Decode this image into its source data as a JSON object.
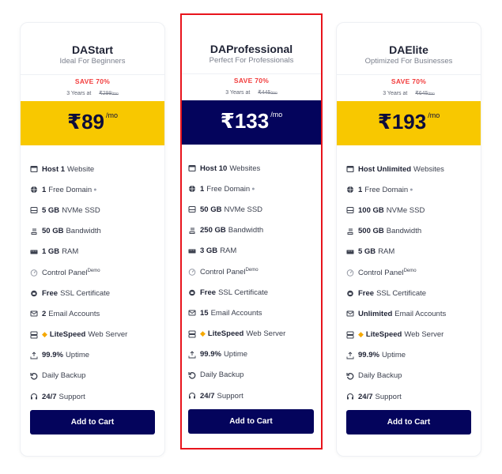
{
  "plans": [
    {
      "name": "DAStart",
      "tagline": "Ideal For Beginners",
      "save": "SAVE 70%",
      "years_label": "3 Years at",
      "old_price": "₹299",
      "old_unit": "/mo",
      "price": "₹89",
      "price_unit": "/mo",
      "features": [
        {
          "icon": "browser-window-icon",
          "bold": "Host 1",
          "text": "Website"
        },
        {
          "icon": "globe-icon",
          "bold": "1",
          "text": "Free Domain",
          "info": "info-icon"
        },
        {
          "icon": "ssd-icon",
          "bold": "5 GB",
          "text": "NVMe SSD"
        },
        {
          "icon": "bandwidth-icon",
          "bold": "50 GB",
          "text": "Bandwidth"
        },
        {
          "icon": "ram-icon",
          "bold": "1 GB",
          "text": "RAM"
        },
        {
          "icon": "dashboard-icon",
          "bold": "",
          "text": "Control Panel",
          "sup": "Demo"
        },
        {
          "icon": "ssl-icon",
          "bold": "Free",
          "text": "SSL Certificate"
        },
        {
          "icon": "email-icon",
          "bold": "2",
          "text": "Email Accounts"
        },
        {
          "icon": "server-icon",
          "bold": "LiteSpeed",
          "text": "Web Server",
          "litespeed": true
        },
        {
          "icon": "uptime-icon",
          "bold": "99.9%",
          "text": "Uptime"
        },
        {
          "icon": "backup-icon",
          "bold": "",
          "text": "Daily Backup"
        },
        {
          "icon": "headset-icon",
          "bold": "24/7",
          "text": "Support"
        }
      ],
      "button": "Add to Cart"
    },
    {
      "name": "DAProfessional",
      "tagline": "Perfect For Professionals",
      "save": "SAVE 70%",
      "years_label": "3 Years at",
      "old_price": "₹445",
      "old_unit": "/mo",
      "price": "₹133",
      "price_unit": "/mo",
      "features": [
        {
          "icon": "browser-window-icon",
          "bold": "Host 10",
          "text": "Websites"
        },
        {
          "icon": "globe-icon",
          "bold": "1",
          "text": "Free Domain",
          "info": "info-icon"
        },
        {
          "icon": "ssd-icon",
          "bold": "50 GB",
          "text": "NVMe SSD"
        },
        {
          "icon": "bandwidth-icon",
          "bold": "250 GB",
          "text": "Bandwidth"
        },
        {
          "icon": "ram-icon",
          "bold": "3 GB",
          "text": "RAM"
        },
        {
          "icon": "dashboard-icon",
          "bold": "",
          "text": "Control Panel",
          "sup": "Demo"
        },
        {
          "icon": "ssl-icon",
          "bold": "Free",
          "text": "SSL Certificate"
        },
        {
          "icon": "email-icon",
          "bold": "15",
          "text": "Email Accounts"
        },
        {
          "icon": "server-icon",
          "bold": "LiteSpeed",
          "text": "Web Server",
          "litespeed": true
        },
        {
          "icon": "uptime-icon",
          "bold": "99.9%",
          "text": "Uptime"
        },
        {
          "icon": "backup-icon",
          "bold": "",
          "text": "Daily Backup"
        },
        {
          "icon": "headset-icon",
          "bold": "24/7",
          "text": "Support"
        }
      ],
      "button": "Add to Cart"
    },
    {
      "name": "DAElite",
      "tagline": "Optimized For Businesses",
      "save": "SAVE 70%",
      "years_label": "3 Years at",
      "old_price": "₹645",
      "old_unit": "/mo",
      "price": "₹193",
      "price_unit": "/mo",
      "features": [
        {
          "icon": "browser-window-icon",
          "bold": "Host Unlimited",
          "text": "Websites"
        },
        {
          "icon": "globe-icon",
          "bold": "1",
          "text": "Free Domain",
          "info": "info-icon"
        },
        {
          "icon": "ssd-icon",
          "bold": "100 GB",
          "text": "NVMe SSD"
        },
        {
          "icon": "bandwidth-icon",
          "bold": "500 GB",
          "text": "Bandwidth"
        },
        {
          "icon": "ram-icon",
          "bold": "5 GB",
          "text": "RAM"
        },
        {
          "icon": "dashboard-icon",
          "bold": "",
          "text": "Control Panel",
          "sup": "Demo"
        },
        {
          "icon": "ssl-icon",
          "bold": "Free",
          "text": "SSL Certificate"
        },
        {
          "icon": "email-icon",
          "bold": "Unlimited",
          "text": "Email Accounts"
        },
        {
          "icon": "server-icon",
          "bold": "LiteSpeed",
          "text": "Web Server",
          "litespeed": true
        },
        {
          "icon": "uptime-icon",
          "bold": "99.9%",
          "text": "Uptime"
        },
        {
          "icon": "backup-icon",
          "bold": "",
          "text": "Daily Backup"
        },
        {
          "icon": "headset-icon",
          "bold": "24/7",
          "text": "Support"
        }
      ],
      "button": "Add to Cart"
    }
  ],
  "colors": {
    "accent_navy": "#04045c",
    "accent_yellow": "#f8c800",
    "save_red": "#f23b3b",
    "highlight_border": "#e8141c"
  }
}
